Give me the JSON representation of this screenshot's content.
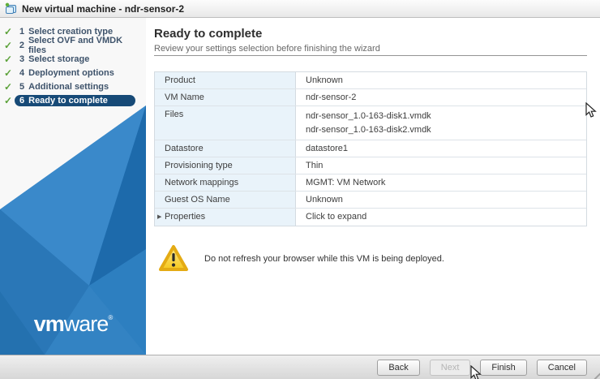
{
  "window": {
    "title": "New virtual machine - ndr-sensor-2"
  },
  "sidebar": {
    "steps": [
      {
        "num": "1",
        "label": "Select creation type",
        "done": true,
        "active": false
      },
      {
        "num": "2",
        "label": "Select OVF and VMDK files",
        "done": true,
        "active": false
      },
      {
        "num": "3",
        "label": "Select storage",
        "done": true,
        "active": false
      },
      {
        "num": "4",
        "label": "Deployment options",
        "done": true,
        "active": false
      },
      {
        "num": "5",
        "label": "Additional settings",
        "done": true,
        "active": false
      },
      {
        "num": "6",
        "label": "Ready to complete",
        "done": true,
        "active": true
      }
    ],
    "logo_vm": "vm",
    "logo_ware": "ware",
    "logo_reg": "®"
  },
  "main": {
    "heading": "Ready to complete",
    "subheading": "Review your settings selection before finishing the wizard",
    "table": {
      "rows": [
        {
          "label": "Product",
          "values": [
            "Unknown"
          ]
        },
        {
          "label": "VM Name",
          "values": [
            "ndr-sensor-2"
          ]
        },
        {
          "label": "Files",
          "values": [
            "ndr-sensor_1.0-163-disk1.vmdk",
            "ndr-sensor_1.0-163-disk2.vmdk"
          ]
        },
        {
          "label": "Datastore",
          "values": [
            "datastore1"
          ]
        },
        {
          "label": "Provisioning type",
          "values": [
            "Thin"
          ]
        },
        {
          "label": "Network mappings",
          "values": [
            "MGMT: VM Network"
          ]
        },
        {
          "label": "Guest OS Name",
          "values": [
            "Unknown"
          ]
        },
        {
          "label": "Properties",
          "values": [
            "Click to expand"
          ],
          "expandable": true
        }
      ]
    },
    "warning_text": "Do not refresh your browser while this VM is being deployed."
  },
  "footer": {
    "buttons": [
      {
        "label": "Back",
        "enabled": true
      },
      {
        "label": "Next",
        "enabled": false
      },
      {
        "label": "Finish",
        "enabled": true
      },
      {
        "label": "Cancel",
        "enabled": true
      }
    ]
  },
  "icons": {
    "check": "✓",
    "expand_arrow": "▶"
  },
  "colors": {
    "accent_blue": "#2e7cbc",
    "active_step_bg": "#174a77",
    "check_green": "#5ca23a",
    "table_label_bg": "#e9f3fa",
    "warning_yellow": "#f9d045"
  }
}
